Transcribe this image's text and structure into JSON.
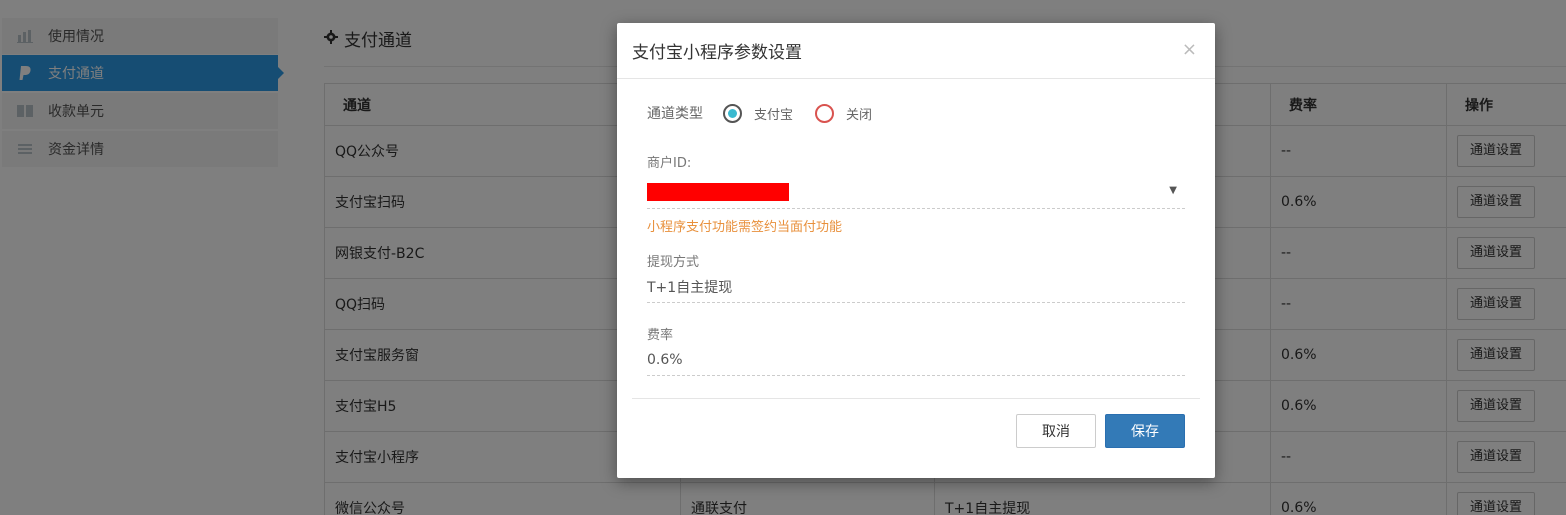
{
  "sidebar": {
    "items": [
      {
        "label": "使用情况",
        "icon": "bar-chart-icon",
        "active": false
      },
      {
        "label": "支付通道",
        "icon": "paypal-icon",
        "active": true
      },
      {
        "label": "收款单元",
        "icon": "grid-icon",
        "active": false
      },
      {
        "label": "资金详情",
        "icon": "list-icon",
        "active": false
      }
    ]
  },
  "main": {
    "title": "支付通道",
    "title_icon": "gear-icon",
    "table": {
      "headers": [
        "通道",
        "",
        "",
        "费率",
        "操作"
      ],
      "rows": [
        {
          "channel": "QQ公众号",
          "provider": "",
          "withdraw": "",
          "rate": "--",
          "action": "通道设置"
        },
        {
          "channel": "支付宝扫码",
          "provider": "",
          "withdraw": "",
          "rate": "0.6%",
          "action": "通道设置"
        },
        {
          "channel": "网银支付-B2C",
          "provider": "",
          "withdraw": "",
          "rate": "--",
          "action": "通道设置"
        },
        {
          "channel": "QQ扫码",
          "provider": "",
          "withdraw": "",
          "rate": "--",
          "action": "通道设置"
        },
        {
          "channel": "支付宝服务窗",
          "provider": "",
          "withdraw": "",
          "rate": "0.6%",
          "action": "通道设置"
        },
        {
          "channel": "支付宝H5",
          "provider": "",
          "withdraw": "",
          "rate": "0.6%",
          "action": "通道设置"
        },
        {
          "channel": "支付宝小程序",
          "provider": "",
          "withdraw": "",
          "rate": "--",
          "action": "通道设置"
        },
        {
          "channel": "微信公众号",
          "provider": "通联支付",
          "withdraw": "T+1自主提现",
          "rate": "0.6%",
          "action": "通道设置"
        }
      ]
    }
  },
  "modal": {
    "title": "支付宝小程序参数设置",
    "close_label": "×",
    "channel_type": {
      "label": "通道类型",
      "options": [
        {
          "label": "支付宝",
          "selected": true
        },
        {
          "label": "关闭",
          "selected": false
        }
      ]
    },
    "merchant_id": {
      "label": "商户ID:",
      "hint": "小程序支付功能需签约当面付功能"
    },
    "withdraw": {
      "label": "提现方式",
      "value": "T+1自主提现"
    },
    "rate": {
      "label": "费率",
      "value": "0.6%"
    },
    "cancel_label": "取消",
    "save_label": "保存"
  },
  "colors": {
    "sidebar_active": "#2d9ae6",
    "save_button": "#337ab7",
    "hint_text": "#e8903c",
    "radio_selected": "#3bbad0",
    "radio_unselected": "#d9534f",
    "redaction": "#ff0000"
  }
}
